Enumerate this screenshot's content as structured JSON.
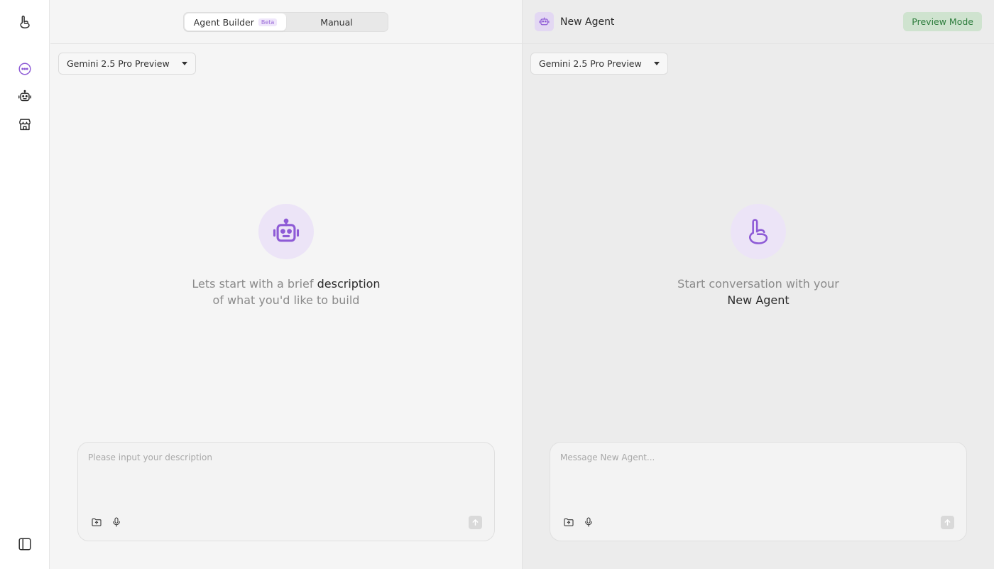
{
  "sidebar": {
    "logo_icon": "hand-logo-icon",
    "items": [
      {
        "name": "chat",
        "icon": "chat-bubble-icon",
        "active": true
      },
      {
        "name": "agents",
        "icon": "robot-icon",
        "active": false
      },
      {
        "name": "store",
        "icon": "store-icon",
        "active": false
      }
    ],
    "bottom_icon": "sidebar-toggle-icon"
  },
  "builder": {
    "tabs": [
      {
        "label": "Agent Builder",
        "badge": "Beta",
        "active": true
      },
      {
        "label": "Manual",
        "active": false
      }
    ],
    "model": "Gemini 2.5 Pro Preview",
    "hero": {
      "line1_prefix": "Lets start with a brief ",
      "line1_strong": "description",
      "line2": "of what you'd like to build"
    },
    "input_placeholder": "Please input your description"
  },
  "preview": {
    "agent_name": "New Agent",
    "mode_badge": "Preview Mode",
    "model": "Gemini 2.5 Pro Preview",
    "hero": {
      "line1": "Start conversation with your",
      "line2_strong": "New Agent"
    },
    "input_placeholder": "Message New Agent..."
  },
  "colors": {
    "accent": "#8e5bd6",
    "accent_bg": "#ece4f7",
    "preview_badge_bg": "#cfe3cf",
    "preview_badge_text": "#2e7d3d"
  }
}
